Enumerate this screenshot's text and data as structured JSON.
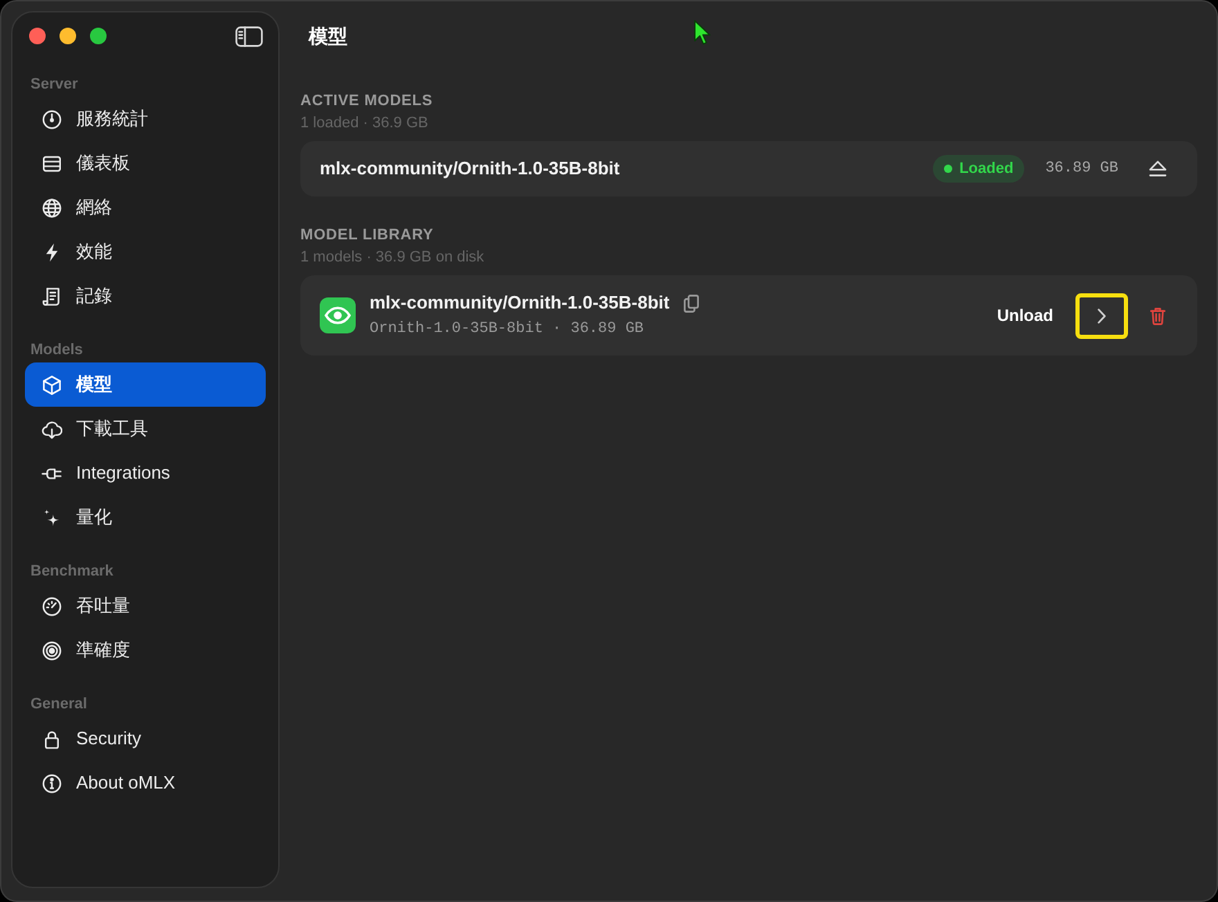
{
  "page_title": "模型",
  "sidebar": {
    "sections": [
      {
        "title": "Server",
        "items": [
          {
            "label": "服務統計",
            "selected": false
          },
          {
            "label": "儀表板",
            "selected": false
          },
          {
            "label": "網絡",
            "selected": false
          },
          {
            "label": "效能",
            "selected": false
          },
          {
            "label": "記錄",
            "selected": false
          }
        ]
      },
      {
        "title": "Models",
        "items": [
          {
            "label": "模型",
            "selected": true
          },
          {
            "label": "下載工具",
            "selected": false
          },
          {
            "label": "Integrations",
            "selected": false
          },
          {
            "label": "量化",
            "selected": false
          }
        ]
      },
      {
        "title": "Benchmark",
        "items": [
          {
            "label": "吞吐量",
            "selected": false
          },
          {
            "label": "準確度",
            "selected": false
          }
        ]
      },
      {
        "title": "General",
        "items": [
          {
            "label": "Security",
            "selected": false
          },
          {
            "label": "About oMLX",
            "selected": false
          }
        ]
      }
    ]
  },
  "active_models": {
    "heading": "ACTIVE MODELS",
    "summary": "1 loaded · 36.9 GB",
    "models": [
      {
        "name": "mlx-community/Ornith-1.0-35B-8bit",
        "status": "Loaded",
        "size": "36.89 GB"
      }
    ]
  },
  "model_library": {
    "heading": "MODEL LIBRARY",
    "summary": "1 models · 36.9 GB on disk",
    "models": [
      {
        "name": "mlx-community/Ornith-1.0-35B-8bit",
        "detail": "Ornith-1.0-35B-8bit · 36.89 GB",
        "action": "Unload",
        "highlighted": true
      }
    ]
  }
}
